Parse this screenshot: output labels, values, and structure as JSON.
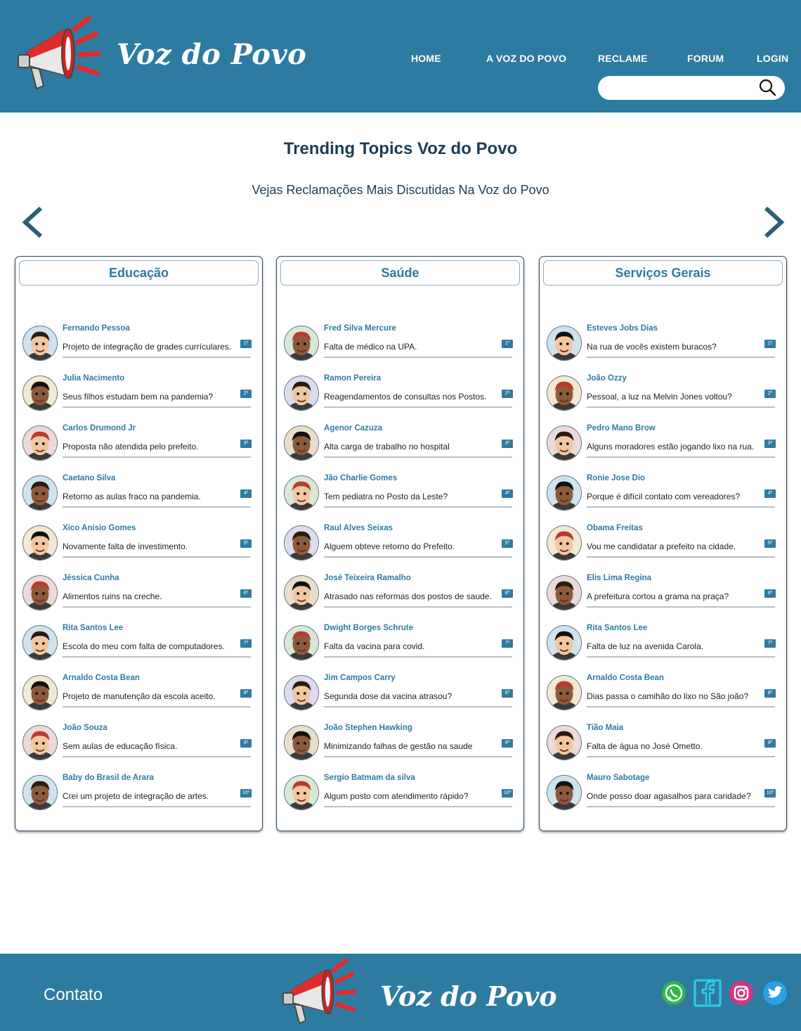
{
  "header": {
    "brand": "Voz do Povo",
    "nav": [
      "HOME",
      "A VOZ DO POVO",
      "RECLAME",
      "FORUM",
      "LOGIN"
    ],
    "search_placeholder": "",
    "search_icon": "search-icon",
    "logo_icon": "megaphone-icon"
  },
  "main": {
    "title": "Trending Topics Voz do Povo",
    "subtitle": "Vejas Reclamações Mais Discutidas Na Voz do Povo",
    "prev_icon": "chevron-left-icon",
    "next_icon": "chevron-right-icon"
  },
  "columns": [
    {
      "title": "Educação",
      "items": [
        {
          "name": "Fernando Pessoa",
          "text": "Projeto de integração de grades currículares.",
          "rank": "1º"
        },
        {
          "name": "Julia Nacimento",
          "text": "Seus filhos estudam bem na pandemia?",
          "rank": "2º"
        },
        {
          "name": "Carlos Drumond Jr",
          "text": "Proposta não atendida pelo prefeito.",
          "rank": "3º"
        },
        {
          "name": "Caetano Silva",
          "text": "Retorno as aulas fraco na pandemia.",
          "rank": "4º"
        },
        {
          "name": "Xico Anisio Gomes",
          "text": "Novamente falta de investimento.",
          "rank": "5º"
        },
        {
          "name": "Jéssica Cunha",
          "text": "Alimentos ruins na creche.",
          "rank": "6º"
        },
        {
          "name": "Rita Santos Lee",
          "text": "Escola do meu com falta de computadores.",
          "rank": "7º"
        },
        {
          "name": "Arnaldo Costa Bean",
          "text": "Projeto de manutenção da escola aceito.",
          "rank": "8º"
        },
        {
          "name": "João Souza",
          "text": "Sem aulas de educação física.",
          "rank": "9º"
        },
        {
          "name": "Baby do Brasil de Arara",
          "text": "Crei um projeto de integração de artes.",
          "rank": "10º"
        }
      ]
    },
    {
      "title": "Saúde",
      "items": [
        {
          "name": "Fred Silva Mercure",
          "text": "Falta de médico na UPA.",
          "rank": "1º"
        },
        {
          "name": "Ramon Pereira",
          "text": "Reagendamentos de consultas nos Postos.",
          "rank": "2º"
        },
        {
          "name": "Agenor Cazuza",
          "text": "Alta carga de trabalho no hospital",
          "rank": "3º"
        },
        {
          "name": "Jão Charlie Gomes",
          "text": "Tem pediatra no Posto da Leste?",
          "rank": "4º"
        },
        {
          "name": "Raul Alves Seixas",
          "text": "Alguem obteve retorno do Prefeito.",
          "rank": "5º"
        },
        {
          "name": "José Teixeira Ramalho",
          "text": "Atrasado nas reformas dos postos de saude.",
          "rank": "6º"
        },
        {
          "name": "Dwight Borges Schrute",
          "text": "Falta da vacina para covid.",
          "rank": "7º"
        },
        {
          "name": "Jim Campos Carry",
          "text": "Segunda dose da vacina atrasou?",
          "rank": "8º"
        },
        {
          "name": "João Stephen Hawking",
          "text": " Minimizando falhas de gestão na saude",
          "rank": "9º"
        },
        {
          "name": "Sergio Batmam da silva",
          "text": "Algum posto com atendimento rápido?",
          "rank": "10º"
        }
      ]
    },
    {
      "title": "Serviços Gerais",
      "items": [
        {
          "name": "Esteves Jobs Dias",
          "text": "Na rua de vocês existem buracos?",
          "rank": "1º"
        },
        {
          "name": "João Ozzy",
          "text": "Pessoal, a luz na Melvin Jones voltou?",
          "rank": "2º"
        },
        {
          "name": "Pedro Mano Brow",
          "text": "Alguns moradores estão jogando lixo na rua.",
          "rank": "3º"
        },
        {
          "name": "Ronie Jose Dio",
          "text": "Porque é difícil contato com vereadores?",
          "rank": "4º"
        },
        {
          "name": "Obama Freitas",
          "text": "Vou me candidatar a prefeito na cidade.",
          "rank": "5º"
        },
        {
          "name": "Elis Lima Regina",
          "text": "A prefeitura cortou a grama na praça?",
          "rank": "6º"
        },
        {
          "name": "Rita Santos Lee",
          "text": "Falta de luz na avenida Carola.",
          "rank": "7º"
        },
        {
          "name": "Arnaldo Costa Bean",
          "text": "Dias passa o camihão do lixo no São joão?",
          "rank": "8º"
        },
        {
          "name": "Tião Maia",
          "text": "Falta de água no José Ometto.",
          "rank": "9º"
        },
        {
          "name": "Mauro Sabotage",
          "text": "Onde posso doar agasalhos para caridade?",
          "rank": "10º"
        }
      ]
    }
  ],
  "footer": {
    "contact": "Contato",
    "brand": "Voz do Povo",
    "social": [
      "whatsapp-icon",
      "facebook-icon",
      "instagram-icon",
      "twitter-icon"
    ]
  },
  "colors": {
    "primary": "#2e7ba1",
    "title": "#1b3e56",
    "megaphone_red": "#e02b2b"
  }
}
